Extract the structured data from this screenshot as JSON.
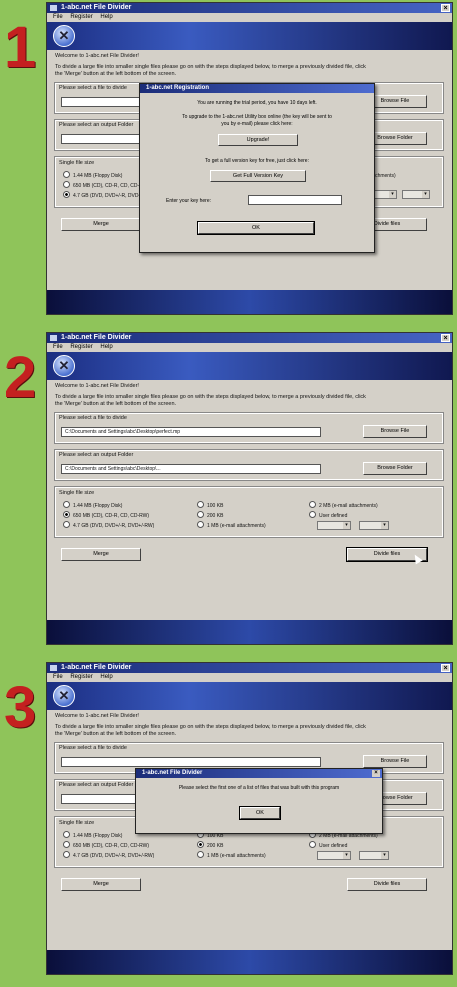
{
  "steps": [
    {
      "number": "1"
    },
    {
      "number": "2"
    },
    {
      "number": "3"
    }
  ],
  "app": {
    "title": "1-abc.net File Divider",
    "menu": [
      "File",
      "Register",
      "Help"
    ],
    "welcome": "Welcome to 1-abc.net File Divider!",
    "instructions_1": "To divide a large file into smaller single files please go on with the steps displayed below, to merge a previously divided file, click",
    "instructions_2": "the 'Merge' button at the left bottom of the screen.",
    "select_file_label": "Please select a file to divide",
    "select_folder_label": "Please select an output Folder",
    "browse_file": "Browse File",
    "browse_folder": "Browse Folder",
    "size_label": "Single file size",
    "sizes": [
      "1.44 MB (Floppy Disk)",
      "650 MB (CD), CD-R, CD, CD-RW)",
      "4.7 GB (DVD, DVD+/-R, DVD+/-RW)",
      "100 KB",
      "200 KB",
      "1 MB (e-mail attachments)",
      "2 MB (e-mail attachments)",
      "User defined"
    ],
    "merge": "Merge",
    "divide": "Divide files",
    "file_path": "C:\\Documents and Settings\\abc\\Desktop\\perfect.mp",
    "folder_path": "C:\\Documents and Settings\\abc\\Desktop\\..."
  },
  "registration": {
    "title": "1-abc.net Registration",
    "line1": "You are running the trial period, you have 10 days left.",
    "line2": "To upgrade to the 1-abc.net Utility box online (the key will be sent to",
    "line3": "you by e-mail) please click here:",
    "upgrade": "Upgrade!",
    "line4": "To get a full version key for free, just click here:",
    "get_key": "Get Full Version Key",
    "key_label": "Enter your key here:",
    "ok": "OK"
  },
  "error_dialog": {
    "title": "1-abc.net File Divider",
    "message": "Please select the first one of a list of files that was built with this program",
    "ok": "OK"
  },
  "colors": {
    "background": "#8fc45a",
    "step_number": "#c42020"
  }
}
